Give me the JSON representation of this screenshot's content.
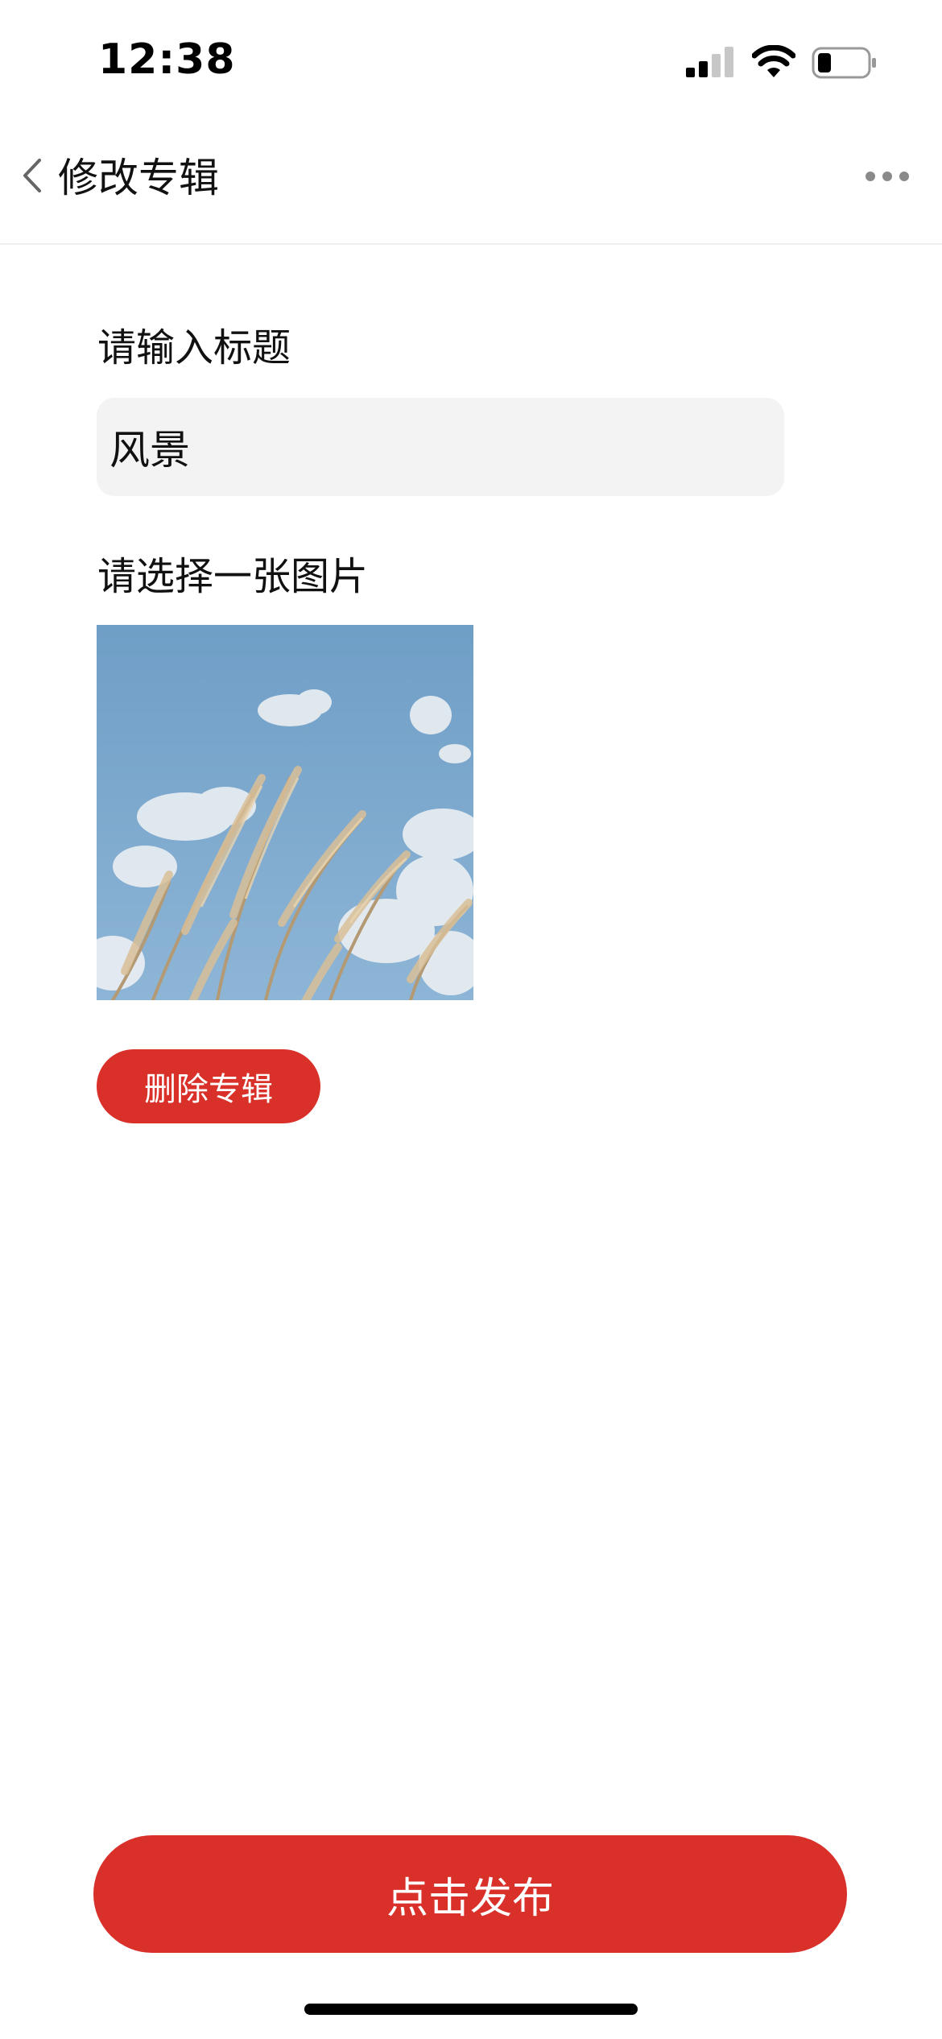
{
  "status_bar": {
    "time": "12:38",
    "signal_icon": "cellular-signal-icon",
    "wifi_icon": "wifi-icon",
    "battery_icon": "battery-icon"
  },
  "nav": {
    "back_icon": "chevron-left-icon",
    "title": "修改专辑",
    "more_icon": "more-dots-icon"
  },
  "form": {
    "title_label": "请输入标题",
    "title_value": "风景",
    "image_label": "请选择一张图片",
    "delete_label": "删除专辑"
  },
  "footer": {
    "publish_label": "点击发布"
  },
  "colors": {
    "accent": "#d9302a",
    "input_bg": "#f3f3f3"
  }
}
